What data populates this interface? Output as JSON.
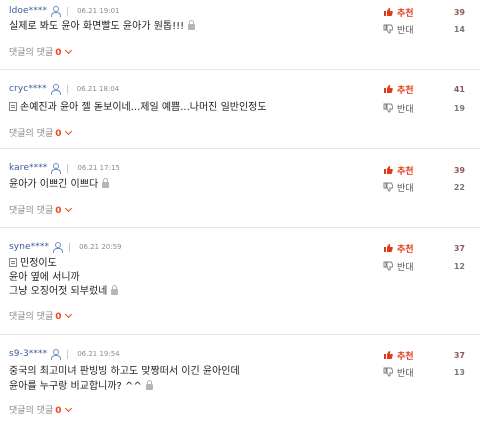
{
  "labels": {
    "recommend": "추천",
    "oppose": "반대",
    "reply": "댓글의 댓글",
    "reply_count": "0"
  },
  "comments": [
    {
      "user": "ldoe****",
      "date": "06.21 19:01",
      "lines": [
        "실제로 봐도 윤아 화면빨도 윤아가 원톱!!!"
      ],
      "doc_icon": false,
      "up": "39",
      "down": "14"
    },
    {
      "user": "cryc****",
      "date": "06.21 18:04",
      "lines": [
        "손예진과 윤아 젤 돋보이네...제일 예쁨...나머진 일반인정도"
      ],
      "doc_icon": true,
      "up": "41",
      "down": "19"
    },
    {
      "user": "kare****",
      "date": "06.21 17:15",
      "lines": [
        "윤아가 이쁘긴 이쁘다"
      ],
      "doc_icon": false,
      "up": "39",
      "down": "22"
    },
    {
      "user": "syne****",
      "date": "06.21 20:59",
      "lines": [
        "민정이도",
        "윤아 옆에 서니까",
        "그냥 오징어젓 되부렀네"
      ],
      "doc_icon": true,
      "up": "37",
      "down": "12"
    },
    {
      "user": "s9-3****",
      "date": "06.21 19:54",
      "lines": [
        "중국의 최고미녀 판빙빙 하고도 맞짱떠서 이긴 윤아인데",
        "윤아를 누구랑 비교합니까? ^^"
      ],
      "doc_icon": false,
      "up": "37",
      "down": "13"
    }
  ],
  "colors": {
    "recommend": "#e03a1a",
    "reply_count": "#e84a1a",
    "user_id": "#3a5a9a"
  }
}
